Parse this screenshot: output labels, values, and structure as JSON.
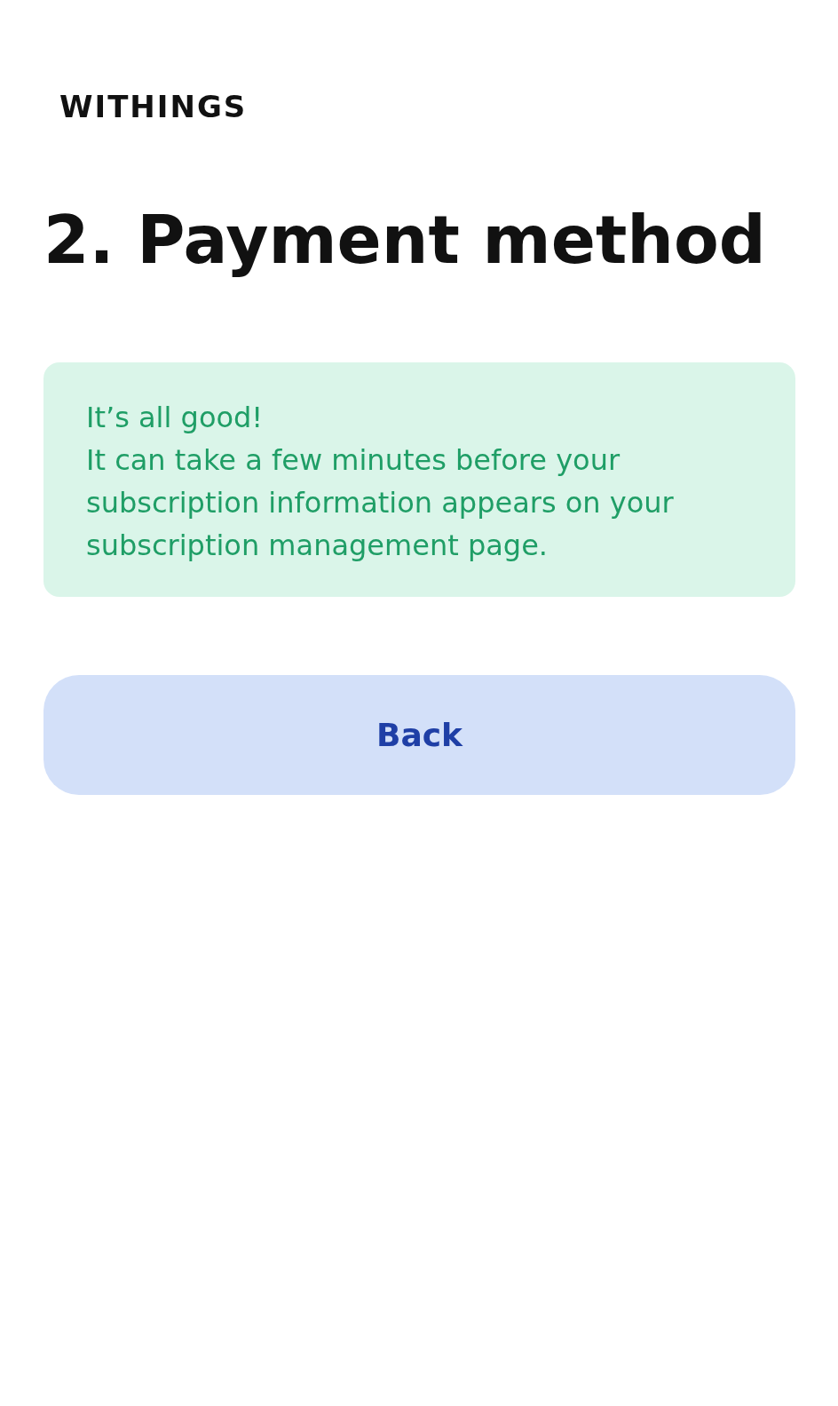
{
  "brand": {
    "logo": "WITHINGS"
  },
  "heading": "2. Payment method",
  "notice": {
    "title": "It’s all good!",
    "message": "It can take a few minutes before your subscription information appears on your subscription management page."
  },
  "buttons": [
    {
      "label": "Back"
    }
  ]
}
